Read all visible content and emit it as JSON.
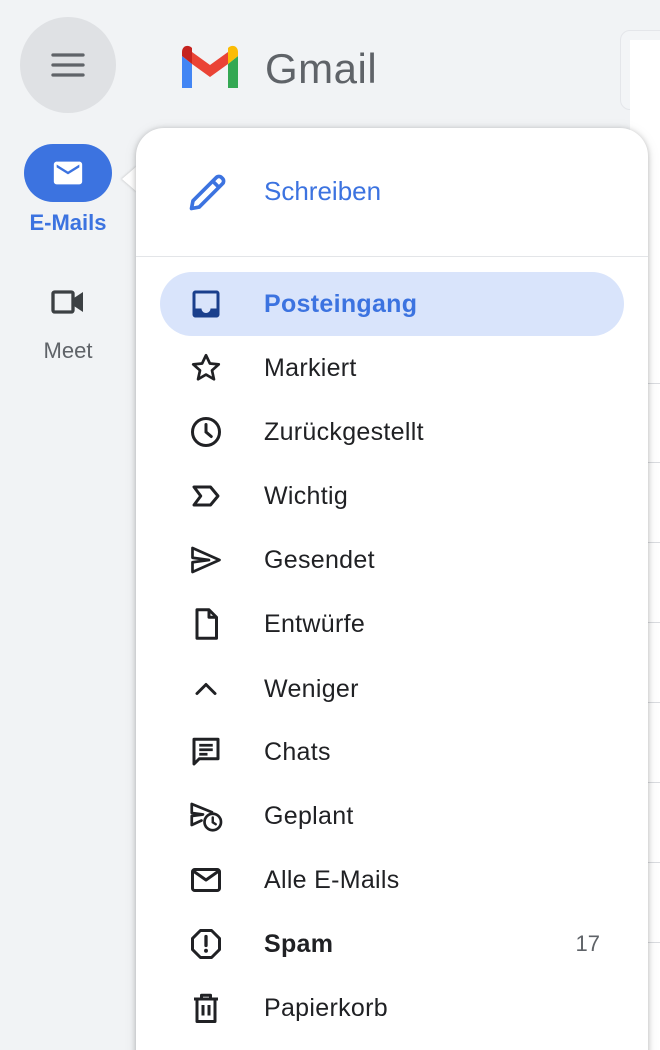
{
  "app": {
    "name": "Gmail"
  },
  "rail": {
    "mail_label": "E-Mails",
    "meet_label": "Meet"
  },
  "drawer": {
    "compose_label": "Schreiben",
    "items": [
      {
        "label": "Posteingang",
        "icon": "inbox-icon",
        "active": true
      },
      {
        "label": "Markiert",
        "icon": "star-icon"
      },
      {
        "label": "Zurückgestellt",
        "icon": "clock-icon"
      },
      {
        "label": "Wichtig",
        "icon": "important-icon"
      },
      {
        "label": "Gesendet",
        "icon": "send-icon"
      },
      {
        "label": "Entwürfe",
        "icon": "draft-icon"
      },
      {
        "label": "Weniger",
        "icon": "chevron-up-icon"
      },
      {
        "label": "Chats",
        "icon": "chat-icon"
      },
      {
        "label": "Geplant",
        "icon": "scheduled-send-icon"
      },
      {
        "label": "Alle E-Mails",
        "icon": "mail-icon"
      },
      {
        "label": "Spam",
        "icon": "spam-icon",
        "count": "17",
        "bold": true
      },
      {
        "label": "Papierkorb",
        "icon": "trash-icon"
      }
    ]
  },
  "colors": {
    "accent": "#3c73e0",
    "active_bg": "#d9e4fb",
    "page_bg": "#f1f3f5"
  }
}
